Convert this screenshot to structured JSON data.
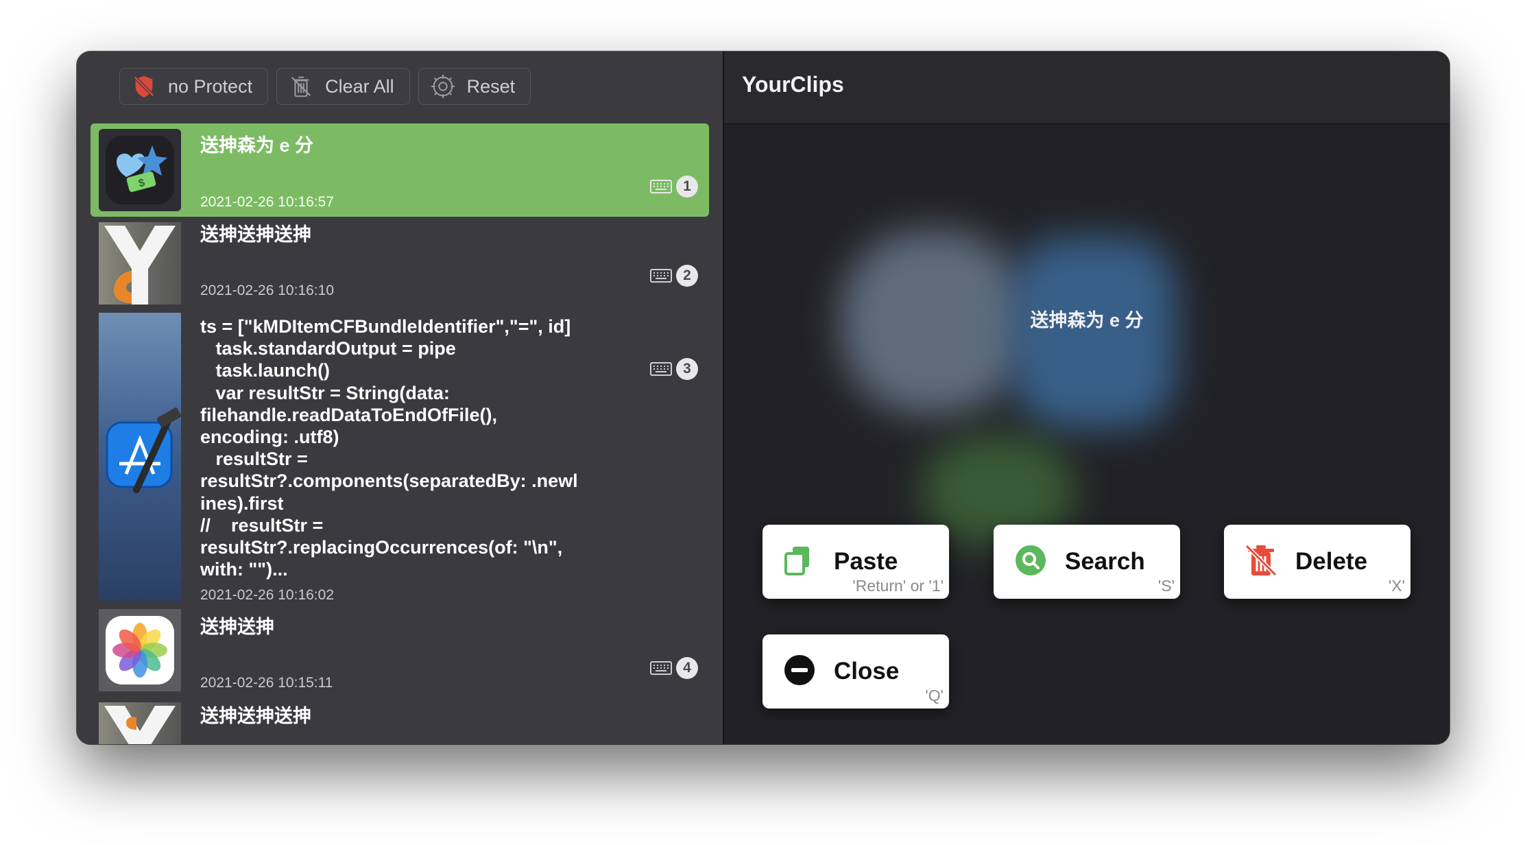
{
  "toolbar": {
    "protect_label": "no Protect",
    "clear_label": "Clear All",
    "reset_label": "Reset"
  },
  "clips": [
    {
      "title": "送抻森为 e 分",
      "date": "2021-02-26 10:16:57",
      "shortcut": "1",
      "app_icon": "app-store-stickers-icon",
      "selected": true
    },
    {
      "title": "送抻送抻送抻",
      "date": "2021-02-26 10:16:10",
      "shortcut": "2",
      "app_icon": "yourclips-icon"
    },
    {
      "title": "ts = [\"kMDItemCFBundleIdentifier\",\"=\", id]\n   task.standardOutput = pipe\n   task.launch()\n   var resultStr = String(data:\nfilehandle.readDataToEndOfFile(),\nencoding: .utf8)\n   resultStr =\nresultStr?.components(separatedBy: .newl\nines).first\n//    resultStr =\nresultStr?.replacingOccurrences(of: \"\\n\",\nwith: \"\")...",
      "date": "2021-02-26 10:16:02",
      "shortcut": "3",
      "app_icon": "xcode-icon"
    },
    {
      "title": "送抻送抻",
      "date": "2021-02-26 10:15:11",
      "shortcut": "4",
      "app_icon": "photos-icon"
    },
    {
      "title": "送抻送抻送抻",
      "app_icon": "yourclips-icon"
    }
  ],
  "detail": {
    "app_name": "YourClips",
    "preview_text": "送抻森为 e 分"
  },
  "actions": {
    "paste": {
      "label": "Paste",
      "hint": "'Return' or '1'",
      "color": "#5cb85c"
    },
    "search": {
      "label": "Search",
      "hint": "'S'",
      "color": "#5cb85c"
    },
    "delete": {
      "label": "Delete",
      "hint": "'X'",
      "color": "#e74c3c"
    },
    "close": {
      "label": "Close",
      "hint": "'Q'",
      "color": "#111111"
    }
  },
  "colors": {
    "selected_row": "#7cbb63",
    "left_bg": "#3b3b3f",
    "right_bg": "#222226"
  }
}
